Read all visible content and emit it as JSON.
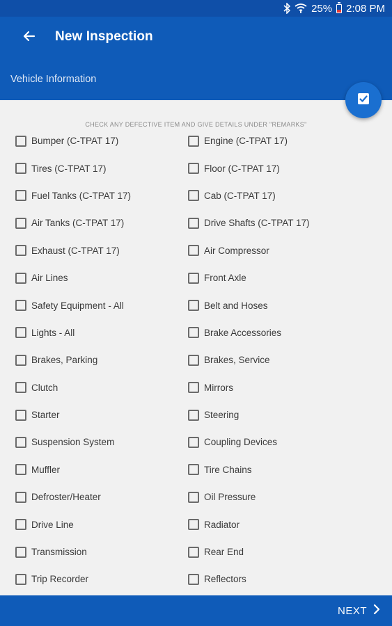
{
  "status_bar": {
    "battery_text": "25%",
    "time": "2:08 PM",
    "icons": [
      "bluetooth-icon",
      "wifi-icon",
      "battery-icon"
    ],
    "battery_level_fraction": 0.25
  },
  "app_bar": {
    "title": "New Inspection",
    "subtitle": "Vehicle Information",
    "back_icon": "arrow-left-icon"
  },
  "fab": {
    "icon": "checkbox-checked-icon"
  },
  "instructions": "CHECK ANY DEFECTIVE ITEM AND GIVE DETAILS UNDER \"REMARKS\"",
  "items_left": [
    {
      "label": "Bumper (C-TPAT 17)",
      "checked": false
    },
    {
      "label": "Tires (C-TPAT 17)",
      "checked": false
    },
    {
      "label": "Fuel Tanks (C-TPAT 17)",
      "checked": false
    },
    {
      "label": "Air Tanks (C-TPAT 17)",
      "checked": false
    },
    {
      "label": "Exhaust (C-TPAT 17)",
      "checked": false
    },
    {
      "label": "Air Lines",
      "checked": false
    },
    {
      "label": "Safety Equipment - All",
      "checked": false
    },
    {
      "label": "Lights - All",
      "checked": false
    },
    {
      "label": "Brakes, Parking",
      "checked": false
    },
    {
      "label": "Clutch",
      "checked": false
    },
    {
      "label": "Starter",
      "checked": false
    },
    {
      "label": "Suspension System",
      "checked": false
    },
    {
      "label": "Muffler",
      "checked": false
    },
    {
      "label": "Defroster/Heater",
      "checked": false
    },
    {
      "label": "Drive Line",
      "checked": false
    },
    {
      "label": "Transmission",
      "checked": false
    },
    {
      "label": "Trip Recorder",
      "checked": false
    }
  ],
  "items_right": [
    {
      "label": "Engine (C-TPAT 17)",
      "checked": false
    },
    {
      "label": "Floor (C-TPAT 17)",
      "checked": false
    },
    {
      "label": "Cab (C-TPAT 17)",
      "checked": false
    },
    {
      "label": "Drive Shafts (C-TPAT 17)",
      "checked": false
    },
    {
      "label": "Air Compressor",
      "checked": false
    },
    {
      "label": "Front Axle",
      "checked": false
    },
    {
      "label": "Belt and Hoses",
      "checked": false
    },
    {
      "label": "Brake Accessories",
      "checked": false
    },
    {
      "label": "Brakes, Service",
      "checked": false
    },
    {
      "label": "Mirrors",
      "checked": false
    },
    {
      "label": "Steering",
      "checked": false
    },
    {
      "label": "Coupling Devices",
      "checked": false
    },
    {
      "label": "Tire Chains",
      "checked": false
    },
    {
      "label": "Oil Pressure",
      "checked": false
    },
    {
      "label": "Radiator",
      "checked": false
    },
    {
      "label": "Rear End",
      "checked": false
    },
    {
      "label": "Reflectors",
      "checked": false
    }
  ],
  "bottom_bar": {
    "next_label": "NEXT",
    "next_icon": "chevron-right-icon"
  },
  "colors": {
    "primary": "#0f5bb8",
    "status_bar": "#0f4fa8",
    "fab": "#1a6fd0",
    "background": "#f1f1f1"
  }
}
